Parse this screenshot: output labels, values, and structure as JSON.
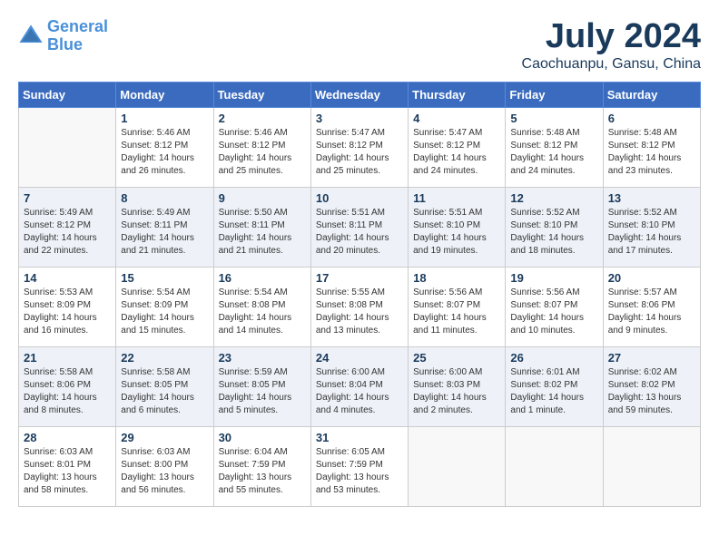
{
  "logo": {
    "line1": "General",
    "line2": "Blue"
  },
  "title": "July 2024",
  "location": "Caochuanpu, Gansu, China",
  "headers": [
    "Sunday",
    "Monday",
    "Tuesday",
    "Wednesday",
    "Thursday",
    "Friday",
    "Saturday"
  ],
  "weeks": [
    [
      {
        "day": "",
        "info": ""
      },
      {
        "day": "1",
        "info": "Sunrise: 5:46 AM\nSunset: 8:12 PM\nDaylight: 14 hours\nand 26 minutes."
      },
      {
        "day": "2",
        "info": "Sunrise: 5:46 AM\nSunset: 8:12 PM\nDaylight: 14 hours\nand 25 minutes."
      },
      {
        "day": "3",
        "info": "Sunrise: 5:47 AM\nSunset: 8:12 PM\nDaylight: 14 hours\nand 25 minutes."
      },
      {
        "day": "4",
        "info": "Sunrise: 5:47 AM\nSunset: 8:12 PM\nDaylight: 14 hours\nand 24 minutes."
      },
      {
        "day": "5",
        "info": "Sunrise: 5:48 AM\nSunset: 8:12 PM\nDaylight: 14 hours\nand 24 minutes."
      },
      {
        "day": "6",
        "info": "Sunrise: 5:48 AM\nSunset: 8:12 PM\nDaylight: 14 hours\nand 23 minutes."
      }
    ],
    [
      {
        "day": "7",
        "info": "Sunrise: 5:49 AM\nSunset: 8:12 PM\nDaylight: 14 hours\nand 22 minutes."
      },
      {
        "day": "8",
        "info": "Sunrise: 5:49 AM\nSunset: 8:11 PM\nDaylight: 14 hours\nand 21 minutes."
      },
      {
        "day": "9",
        "info": "Sunrise: 5:50 AM\nSunset: 8:11 PM\nDaylight: 14 hours\nand 21 minutes."
      },
      {
        "day": "10",
        "info": "Sunrise: 5:51 AM\nSunset: 8:11 PM\nDaylight: 14 hours\nand 20 minutes."
      },
      {
        "day": "11",
        "info": "Sunrise: 5:51 AM\nSunset: 8:10 PM\nDaylight: 14 hours\nand 19 minutes."
      },
      {
        "day": "12",
        "info": "Sunrise: 5:52 AM\nSunset: 8:10 PM\nDaylight: 14 hours\nand 18 minutes."
      },
      {
        "day": "13",
        "info": "Sunrise: 5:52 AM\nSunset: 8:10 PM\nDaylight: 14 hours\nand 17 minutes."
      }
    ],
    [
      {
        "day": "14",
        "info": "Sunrise: 5:53 AM\nSunset: 8:09 PM\nDaylight: 14 hours\nand 16 minutes."
      },
      {
        "day": "15",
        "info": "Sunrise: 5:54 AM\nSunset: 8:09 PM\nDaylight: 14 hours\nand 15 minutes."
      },
      {
        "day": "16",
        "info": "Sunrise: 5:54 AM\nSunset: 8:08 PM\nDaylight: 14 hours\nand 14 minutes."
      },
      {
        "day": "17",
        "info": "Sunrise: 5:55 AM\nSunset: 8:08 PM\nDaylight: 14 hours\nand 13 minutes."
      },
      {
        "day": "18",
        "info": "Sunrise: 5:56 AM\nSunset: 8:07 PM\nDaylight: 14 hours\nand 11 minutes."
      },
      {
        "day": "19",
        "info": "Sunrise: 5:56 AM\nSunset: 8:07 PM\nDaylight: 14 hours\nand 10 minutes."
      },
      {
        "day": "20",
        "info": "Sunrise: 5:57 AM\nSunset: 8:06 PM\nDaylight: 14 hours\nand 9 minutes."
      }
    ],
    [
      {
        "day": "21",
        "info": "Sunrise: 5:58 AM\nSunset: 8:06 PM\nDaylight: 14 hours\nand 8 minutes."
      },
      {
        "day": "22",
        "info": "Sunrise: 5:58 AM\nSunset: 8:05 PM\nDaylight: 14 hours\nand 6 minutes."
      },
      {
        "day": "23",
        "info": "Sunrise: 5:59 AM\nSunset: 8:05 PM\nDaylight: 14 hours\nand 5 minutes."
      },
      {
        "day": "24",
        "info": "Sunrise: 6:00 AM\nSunset: 8:04 PM\nDaylight: 14 hours\nand 4 minutes."
      },
      {
        "day": "25",
        "info": "Sunrise: 6:00 AM\nSunset: 8:03 PM\nDaylight: 14 hours\nand 2 minutes."
      },
      {
        "day": "26",
        "info": "Sunrise: 6:01 AM\nSunset: 8:02 PM\nDaylight: 14 hours\nand 1 minute."
      },
      {
        "day": "27",
        "info": "Sunrise: 6:02 AM\nSunset: 8:02 PM\nDaylight: 13 hours\nand 59 minutes."
      }
    ],
    [
      {
        "day": "28",
        "info": "Sunrise: 6:03 AM\nSunset: 8:01 PM\nDaylight: 13 hours\nand 58 minutes."
      },
      {
        "day": "29",
        "info": "Sunrise: 6:03 AM\nSunset: 8:00 PM\nDaylight: 13 hours\nand 56 minutes."
      },
      {
        "day": "30",
        "info": "Sunrise: 6:04 AM\nSunset: 7:59 PM\nDaylight: 13 hours\nand 55 minutes."
      },
      {
        "day": "31",
        "info": "Sunrise: 6:05 AM\nSunset: 7:59 PM\nDaylight: 13 hours\nand 53 minutes."
      },
      {
        "day": "",
        "info": ""
      },
      {
        "day": "",
        "info": ""
      },
      {
        "day": "",
        "info": ""
      }
    ]
  ]
}
